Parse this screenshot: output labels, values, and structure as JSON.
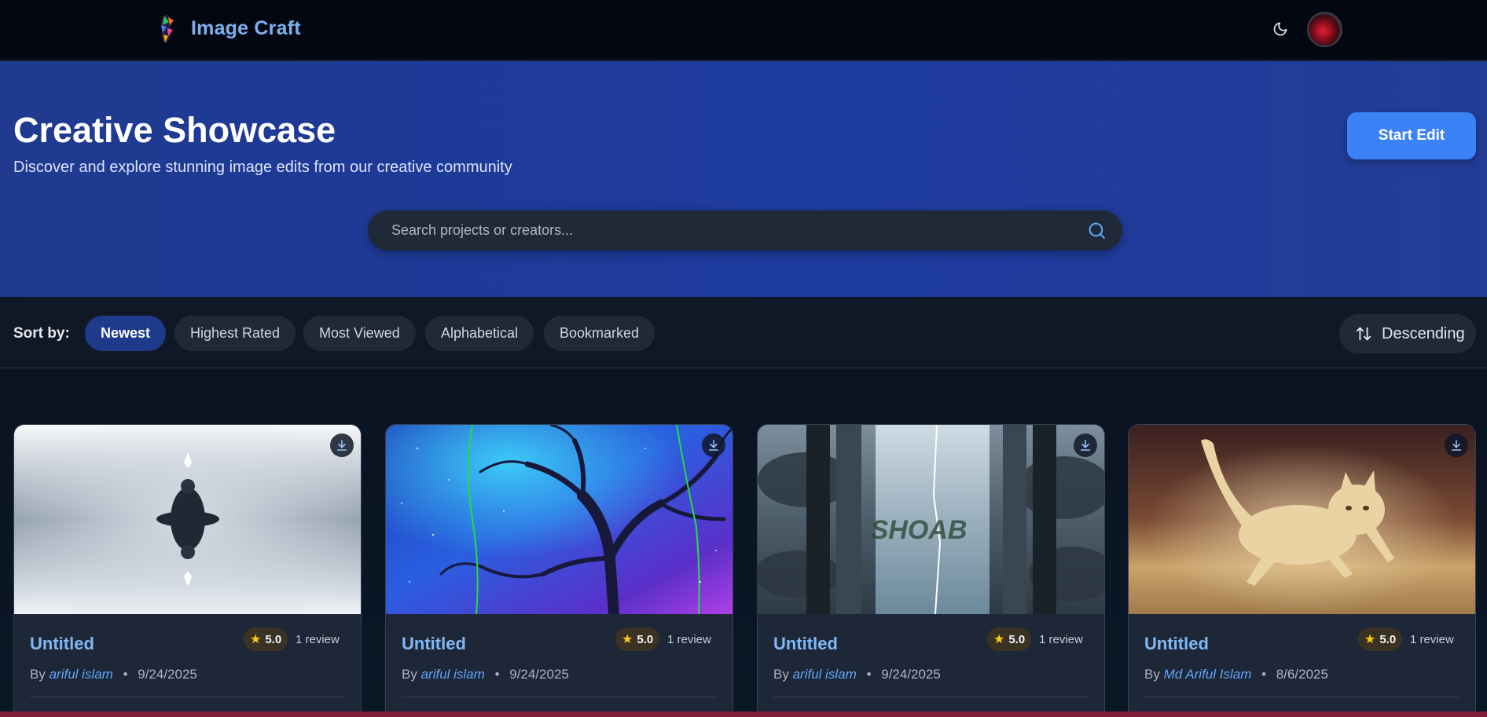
{
  "nav": {
    "brand_name": "Image Craft",
    "theme_icon": "moon-icon",
    "avatar_icon": "user-avatar"
  },
  "hero": {
    "title": "Creative Showcase",
    "subtitle": "Discover and explore stunning image edits from our creative community",
    "start_button": "Start Edit",
    "search": {
      "placeholder": "Search projects or creators...",
      "value": ""
    }
  },
  "sort": {
    "label": "Sort by:",
    "options": [
      "Newest",
      "Highest Rated",
      "Most Viewed",
      "Alphabetical",
      "Bookmarked"
    ],
    "active": "Newest",
    "order_label": "Descending"
  },
  "cards": [
    {
      "title": "Untitled",
      "rating": "5.0",
      "reviews": "1 review",
      "by": "By",
      "author": "ariful islam",
      "sep": "•",
      "date": "9/24/2025"
    },
    {
      "title": "Untitled",
      "rating": "5.0",
      "reviews": "1 review",
      "by": "By",
      "author": "ariful islam",
      "sep": "•",
      "date": "9/24/2025"
    },
    {
      "title": "Untitled",
      "rating": "5.0",
      "reviews": "1 review",
      "by": "By",
      "author": "ariful islam",
      "sep": "•",
      "date": "9/24/2025"
    },
    {
      "title": "Untitled",
      "rating": "5.0",
      "reviews": "1 review",
      "by": "By",
      "author": "Md Ariful Islam",
      "sep": "•",
      "date": "8/6/2025"
    }
  ],
  "thumbnail_text": {
    "card3_watermark": "SHOAB"
  },
  "colors": {
    "accent": "#3b82f6",
    "hero_bg": "#1e3ba0",
    "link": "#60a5fa",
    "star": "#facc15"
  }
}
